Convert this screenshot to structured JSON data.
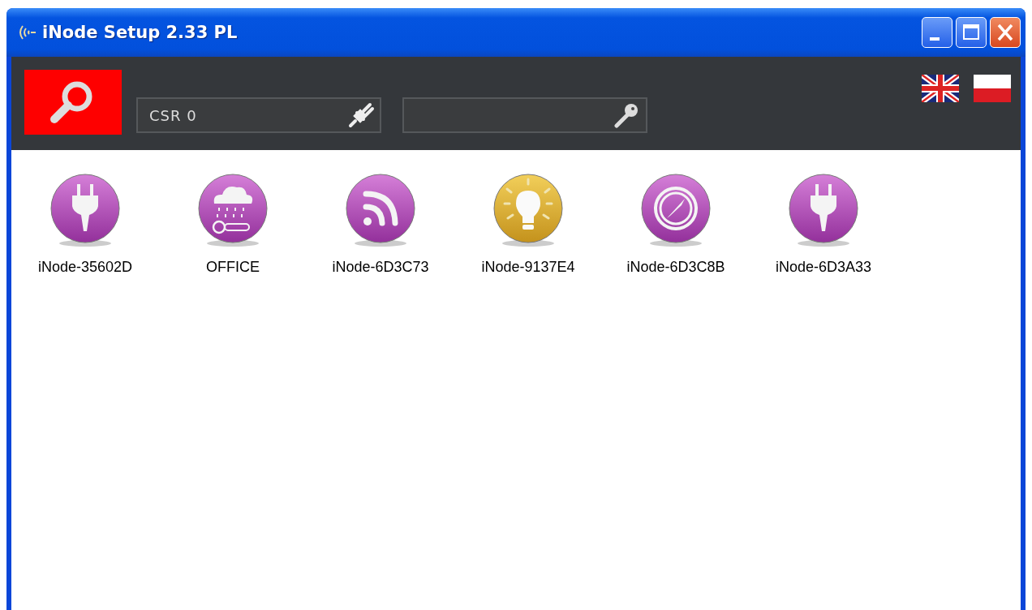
{
  "window": {
    "title": "iNode Setup 2.33 PL"
  },
  "toolbar": {
    "connection_field": {
      "value": "CSR 0"
    }
  },
  "devices": [
    {
      "name": "iNode-35602D",
      "kind": "plug"
    },
    {
      "name": "OFFICE",
      "kind": "weather"
    },
    {
      "name": "iNode-6D3C73",
      "kind": "rss"
    },
    {
      "name": "iNode-9137E4",
      "kind": "bulb"
    },
    {
      "name": "iNode-6D3C8B",
      "kind": "gauge"
    },
    {
      "name": "iNode-6D3A33",
      "kind": "plug"
    }
  ]
}
